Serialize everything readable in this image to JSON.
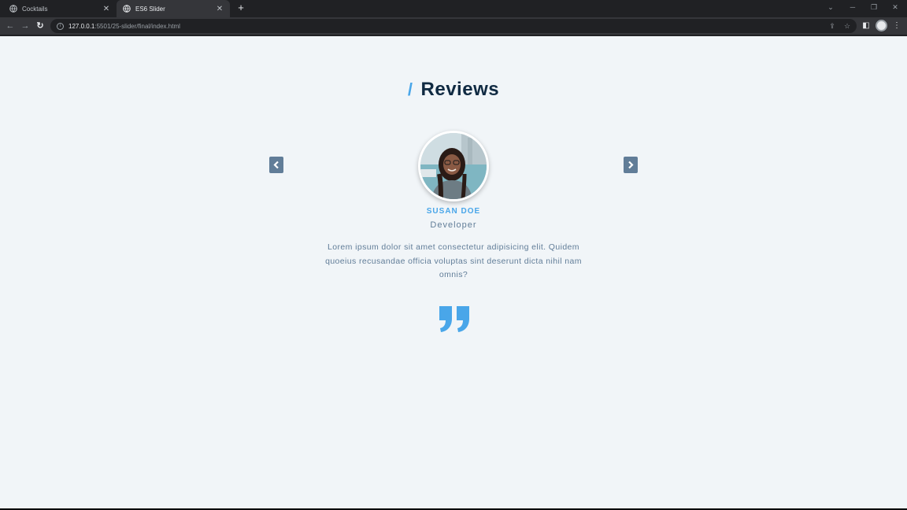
{
  "browser": {
    "tabs": [
      {
        "title": "Cocktails",
        "active": false
      },
      {
        "title": "ES6 Slider",
        "active": true
      }
    ],
    "url_host": "127.0.0.1",
    "url_rest": ":5501/25-slider/final/index.html"
  },
  "page": {
    "heading_slash": "/",
    "heading": "Reviews",
    "person": {
      "name": "susan doe",
      "job": "Developer",
      "text": "Lorem ipsum dolor sit amet consectetur adipisicing elit. Quidem quoeius recusandae officia voluptas sint deserunt dicta nihil nam omnis?"
    },
    "icons": {
      "prev": "chevron-left-icon",
      "next": "chevron-right-icon",
      "quote": "quote-right-icon"
    }
  },
  "colors": {
    "accent": "#49a6e9",
    "heading": "#102a42",
    "text": "#617d98",
    "background": "#f1f5f8",
    "button": "#617d98"
  }
}
